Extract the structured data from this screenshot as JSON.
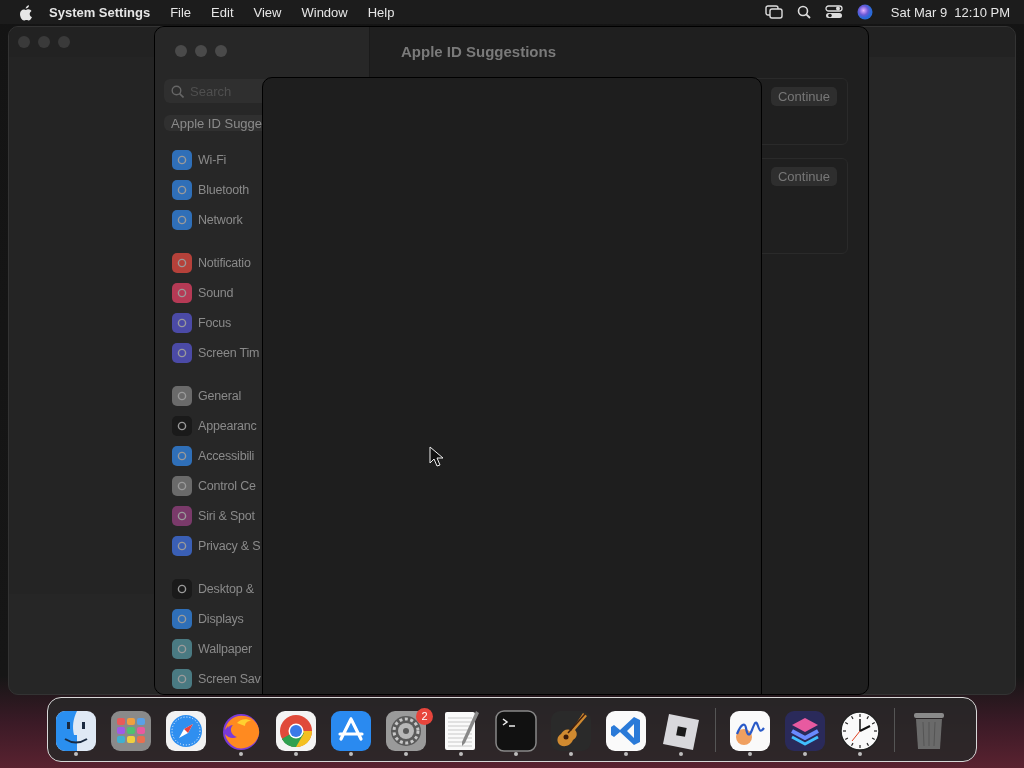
{
  "menu_bar": {
    "app_name": "System Settings",
    "menus": [
      "File",
      "Edit",
      "View",
      "Window",
      "Help"
    ],
    "clock": "Sat Mar 9  12:10 PM"
  },
  "settings_window": {
    "search": {
      "placeholder": "Search"
    },
    "account": "Apple ID Sugge",
    "title": "Apple ID Suggestions",
    "groups": [
      {
        "items": [
          {
            "label": "Wi-Fi",
            "color": "#2f6fb8"
          },
          {
            "label": "Bluetooth",
            "color": "#2f6fb8"
          },
          {
            "label": "Network",
            "color": "#2f6fb8"
          }
        ]
      },
      {
        "items": [
          {
            "label": "Notificatio",
            "color": "#b5413a"
          },
          {
            "label": "Sound",
            "color": "#b53a55"
          },
          {
            "label": "Focus",
            "color": "#4b4aa6"
          },
          {
            "label": "Screen Tim",
            "color": "#4b4aa6"
          }
        ]
      },
      {
        "items": [
          {
            "label": "General",
            "color": "#6a6a6a"
          },
          {
            "label": "Appearanc",
            "color": "#1a1a1a"
          },
          {
            "label": "Accessibili",
            "color": "#2f6fb8"
          },
          {
            "label": "Control Ce",
            "color": "#6a6a6a"
          },
          {
            "label": "Siri & Spot",
            "color": "#7a3a6a"
          },
          {
            "label": "Privacy & S",
            "color": "#3a5fb5"
          }
        ]
      },
      {
        "items": [
          {
            "label": "Desktop &",
            "color": "#1a1a1a"
          },
          {
            "label": "Displays",
            "color": "#2f6fb8"
          },
          {
            "label": "Wallpaper",
            "color": "#4a7a82"
          },
          {
            "label": "Screen Sav",
            "color": "#4a7a82"
          }
        ]
      }
    ],
    "cards": [
      {
        "button": "Continue"
      },
      {
        "button": "Continue"
      }
    ]
  },
  "dock": {
    "apps": [
      {
        "running": true
      },
      {
        "running": false
      },
      {
        "running": false
      },
      {
        "running": true
      },
      {
        "running": true
      },
      {
        "running": true
      },
      {
        "running": true,
        "badge": "2"
      },
      {
        "running": true
      },
      {
        "running": true
      },
      {
        "running": true
      },
      {
        "running": true
      },
      {
        "running": true
      },
      {
        "running": true
      },
      {
        "running": true
      },
      {
        "running": true
      }
    ]
  }
}
